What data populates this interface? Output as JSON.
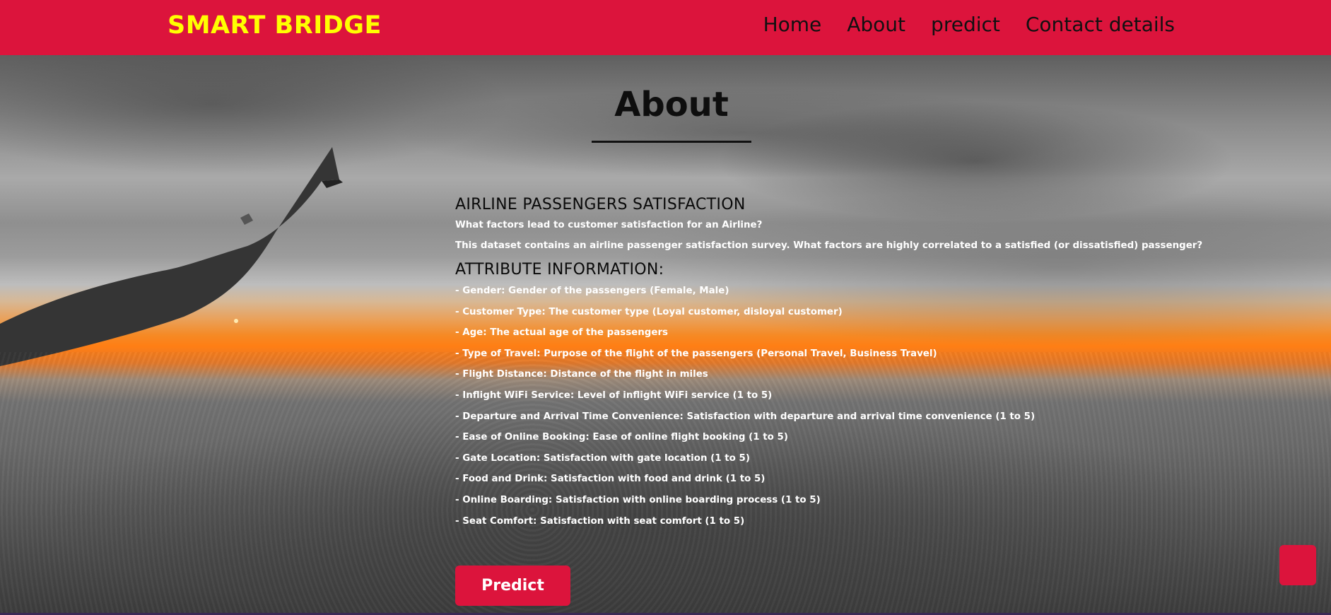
{
  "header": {
    "brand": "SMART BRIDGE",
    "nav": [
      {
        "label": "Home"
      },
      {
        "label": "About"
      },
      {
        "label": "predict"
      },
      {
        "label": "Contact details"
      }
    ]
  },
  "about": {
    "title": "About",
    "heading": "AIRLINE PASSENGERS SATISFACTION",
    "question": "What factors lead to customer satisfaction for an Airline?",
    "description": "This dataset contains an airline passenger satisfaction survey. What factors are highly correlated to a satisfied (or dissatisfied) passenger?",
    "attributes_heading": "ATTRIBUTE INFORMATION:",
    "attributes": [
      "- Gender: Gender of the passengers (Female, Male)",
      "- Customer Type: The customer type (Loyal customer, disloyal customer)",
      "- Age: The actual age of the passengers",
      "- Type of Travel: Purpose of the flight of the passengers (Personal Travel, Business Travel)",
      "- Flight Distance: Distance of the flight in miles",
      "- Inflight WiFi Service: Level of inflight WiFi service (1 to 5)",
      "- Departure and Arrival Time Convenience: Satisfaction with departure and arrival time convenience (1 to 5)",
      "- Ease of Online Booking: Ease of online flight booking (1 to 5)",
      "- Gate Location: Satisfaction with gate location (1 to 5)",
      "- Food and Drink: Satisfaction with food and drink (1 to 5)",
      "- Online Boarding: Satisfaction with online boarding process (1 to 5)",
      "- Seat Comfort: Satisfaction with seat comfort (1 to 5)"
    ],
    "predict_button": "Predict"
  },
  "colors": {
    "header_bg": "#dc143c",
    "brand": "#ffff00",
    "button_bg": "#dc143c",
    "body_text": "#ffffff"
  }
}
